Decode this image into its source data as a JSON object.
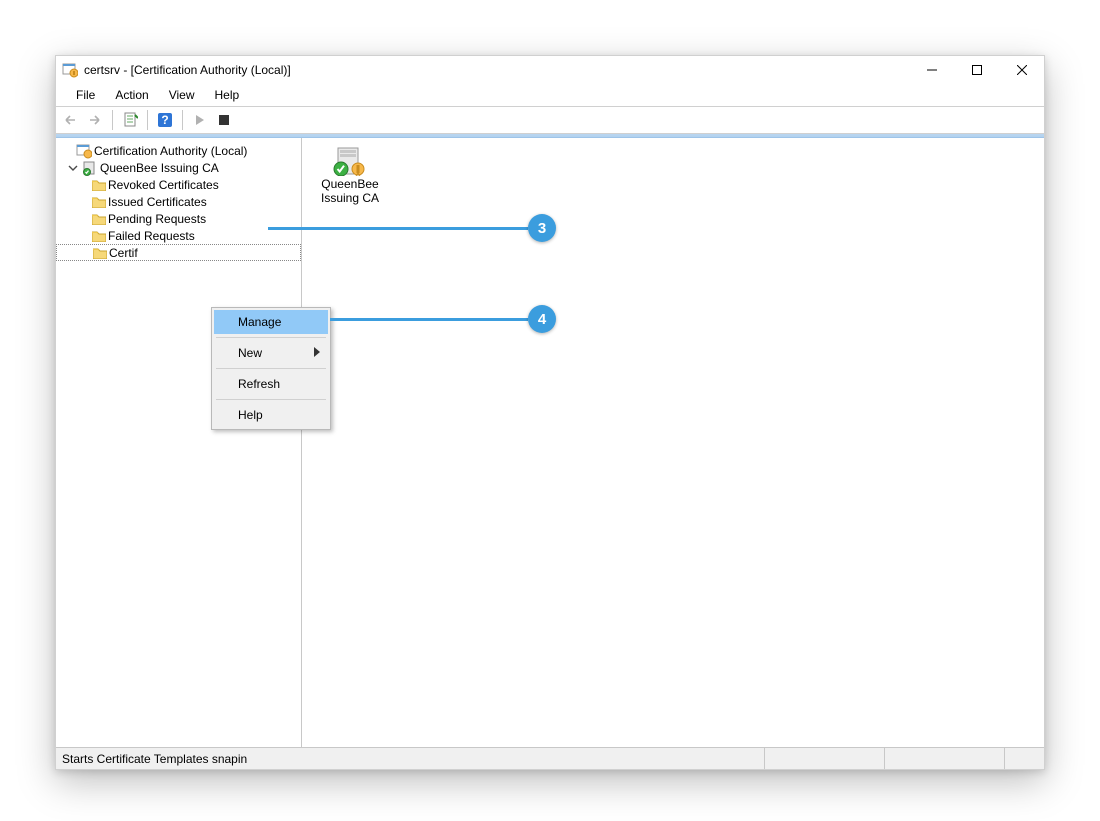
{
  "window": {
    "title": "certsrv - [Certification Authority (Local)]"
  },
  "menu": {
    "file": "File",
    "action": "Action",
    "view": "View",
    "help": "Help"
  },
  "tree": {
    "root": "Certification Authority (Local)",
    "ca": "QueenBee Issuing CA",
    "items": [
      {
        "label": "Revoked Certificates"
      },
      {
        "label": "Issued Certificates"
      },
      {
        "label": "Pending Requests"
      },
      {
        "label": "Failed Requests"
      },
      {
        "label": "Certif"
      }
    ]
  },
  "content": {
    "item_line1": "QueenBee",
    "item_line2": "Issuing CA"
  },
  "context_menu": {
    "manage": "Manage",
    "new": "New",
    "refresh": "Refresh",
    "help": "Help"
  },
  "statusbar": {
    "message": "Starts Certificate Templates snapin"
  },
  "annotations": {
    "step3": "3",
    "step4": "4"
  }
}
